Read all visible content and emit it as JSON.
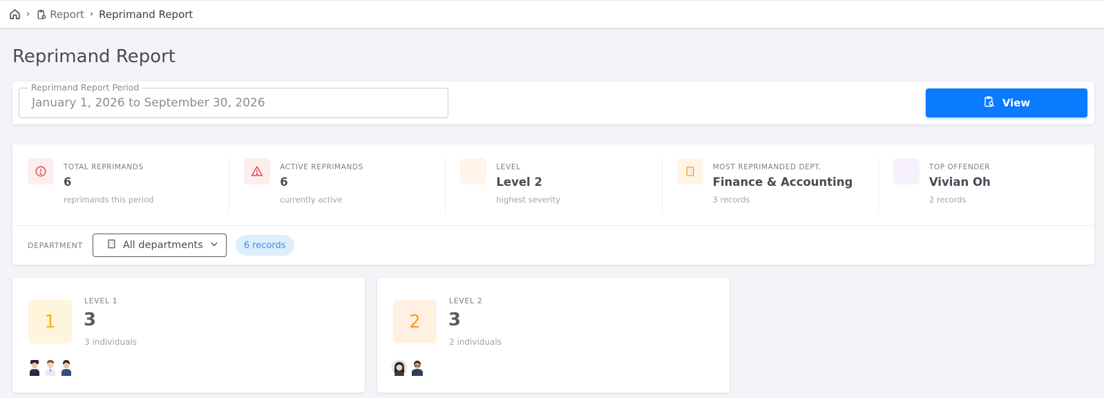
{
  "breadcrumb": {
    "report": "Report",
    "current": "Reprimand Report"
  },
  "page_title": "Reprimand Report",
  "period": {
    "label": "Reprimand Report Period",
    "value": "January 1, 2026 to September 30, 2026"
  },
  "view_button": "View",
  "stats": [
    {
      "label": "TOTAL REPRIMANDS",
      "value": "6",
      "sub": "reprimands this period",
      "icon": "alert-circle-icon",
      "bg": "#fdeeee",
      "color": "#e5484d"
    },
    {
      "label": "ACTIVE REPRIMANDS",
      "value": "6",
      "sub": "currently active",
      "icon": "warning-triangle-icon",
      "bg": "#fdeeee",
      "color": "#e5484d"
    },
    {
      "label": "LEVEL",
      "value": "Level 2",
      "sub": "highest severity",
      "icon": "blank",
      "bg": "#fff3ea",
      "color": "#f39c4f"
    },
    {
      "label": "MOST REPRIMANDED DEPT.",
      "value": "Finance & Accounting",
      "sub": "3 records",
      "icon": "building-icon",
      "bg": "#fff5e6",
      "color": "#f0a030"
    },
    {
      "label": "TOP OFFENDER",
      "value": "Vivian Oh",
      "sub": "2 records",
      "icon": "blank",
      "bg": "#f7f1fb",
      "color": "#b07cd6"
    }
  ],
  "filter": {
    "label": "DEPARTMENT",
    "select_value": "All departments",
    "records": "6 records"
  },
  "levels": [
    {
      "number": "1",
      "label": "LEVEL 1",
      "count": "3",
      "sub": "3 individuals",
      "badge_bg": "#fff4dc",
      "badge_color": "#f6b21b"
    },
    {
      "number": "2",
      "label": "LEVEL 2",
      "count": "3",
      "sub": "2 individuals",
      "badge_bg": "#fff0e2",
      "badge_color": "#f59a23"
    }
  ]
}
